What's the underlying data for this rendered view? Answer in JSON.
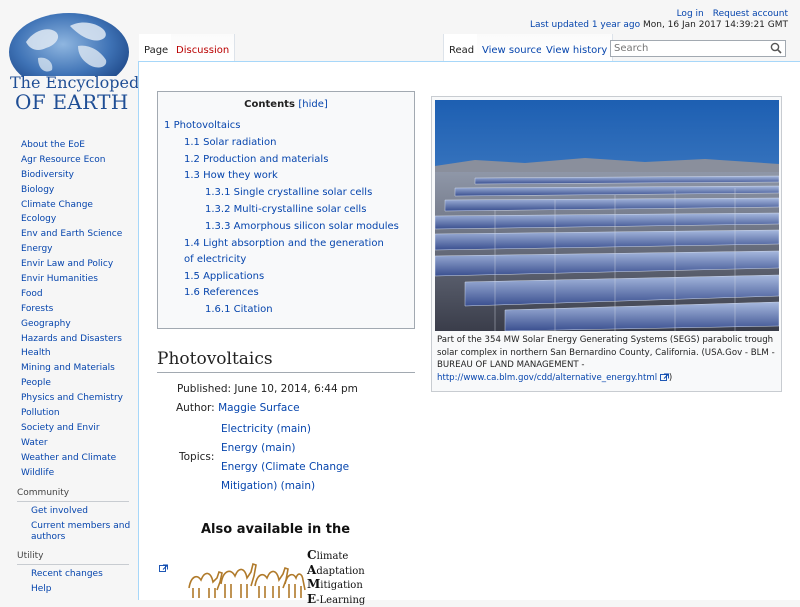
{
  "logo": {
    "line1": "The Encyclopedia",
    "line2": "OF EARTH"
  },
  "nav": {
    "items": [
      "About the EoE",
      "Agr Resource Econ",
      "Biodiversity",
      "Biology",
      "Climate Change",
      "Ecology",
      "Env and Earth Science",
      "Energy",
      "Envir Law and Policy",
      "Envir Humanities",
      "Food",
      "Forests",
      "Geography",
      "Hazards and Disasters",
      "Health",
      "Mining and Materials",
      "People",
      "Physics and Chemistry",
      "Pollution",
      "Society and Envir",
      "Water",
      "Weather and Climate",
      "Wildlife"
    ],
    "community": {
      "heading": "Community",
      "items": [
        "Get involved",
        "Current members and authors"
      ]
    },
    "utility": {
      "heading": "Utility",
      "items": [
        "Recent changes",
        "Help"
      ]
    }
  },
  "header": {
    "login": "Log in",
    "request_account": "Request account",
    "last_updated_label": "Last updated 1 year ago",
    "last_updated_date": "Mon, 16 Jan 2017 14:39:21 GMT",
    "tabs": {
      "page": "Page",
      "discussion": "Discussion",
      "read": "Read",
      "view_source": "View source",
      "view_history": "View history"
    },
    "search_placeholder": "Search"
  },
  "toc": {
    "title": "Contents",
    "hide": "[hide]",
    "entries": [
      {
        "num": "1",
        "text": "Photovoltaics"
      },
      {
        "num": "1.1",
        "text": "Solar radiation"
      },
      {
        "num": "1.2",
        "text": "Production and materials"
      },
      {
        "num": "1.3",
        "text": "How they work"
      },
      {
        "num": "1.3.1",
        "text": "Single crystalline solar cells"
      },
      {
        "num": "1.3.2",
        "text": "Multi-crystalline solar cells"
      },
      {
        "num": "1.3.3",
        "text": "Amorphous silicon solar modules"
      },
      {
        "num": "1.4",
        "text": "Light absorption and the generation of electricity"
      },
      {
        "num": "1.5",
        "text": "Applications"
      },
      {
        "num": "1.6",
        "text": "References"
      },
      {
        "num": "1.6.1",
        "text": "Citation"
      }
    ]
  },
  "figure": {
    "caption_text": "Part of the 354 MW Solar Energy Generating Systems (SEGS) parabolic trough solar complex in northern San Bernardino County, California. (USA.Gov - BLM - BUREAU OF LAND MANAGEMENT - ",
    "caption_link": "http://www.ca.blm.gov/cdd/alternative_energy.html",
    "caption_end": ")"
  },
  "article": {
    "heading": "Photovoltaics",
    "published": "Published: June 10, 2014, 6:44 pm",
    "author_label": "Author:",
    "author_name": "Maggie Surface",
    "topics_label": "Topics:",
    "topics": [
      "Electricity (main)",
      "Energy (main)",
      "Energy (Climate Change",
      "Mitigation) (main)"
    ]
  },
  "banner": {
    "also": "Also available in the",
    "acronym": [
      {
        "initial": "C",
        "rest": "limate"
      },
      {
        "initial": "A",
        "rest": "daptation"
      },
      {
        "initial": "M",
        "rest": "itigation"
      },
      {
        "initial": "E",
        "rest": "-Learning"
      }
    ]
  }
}
